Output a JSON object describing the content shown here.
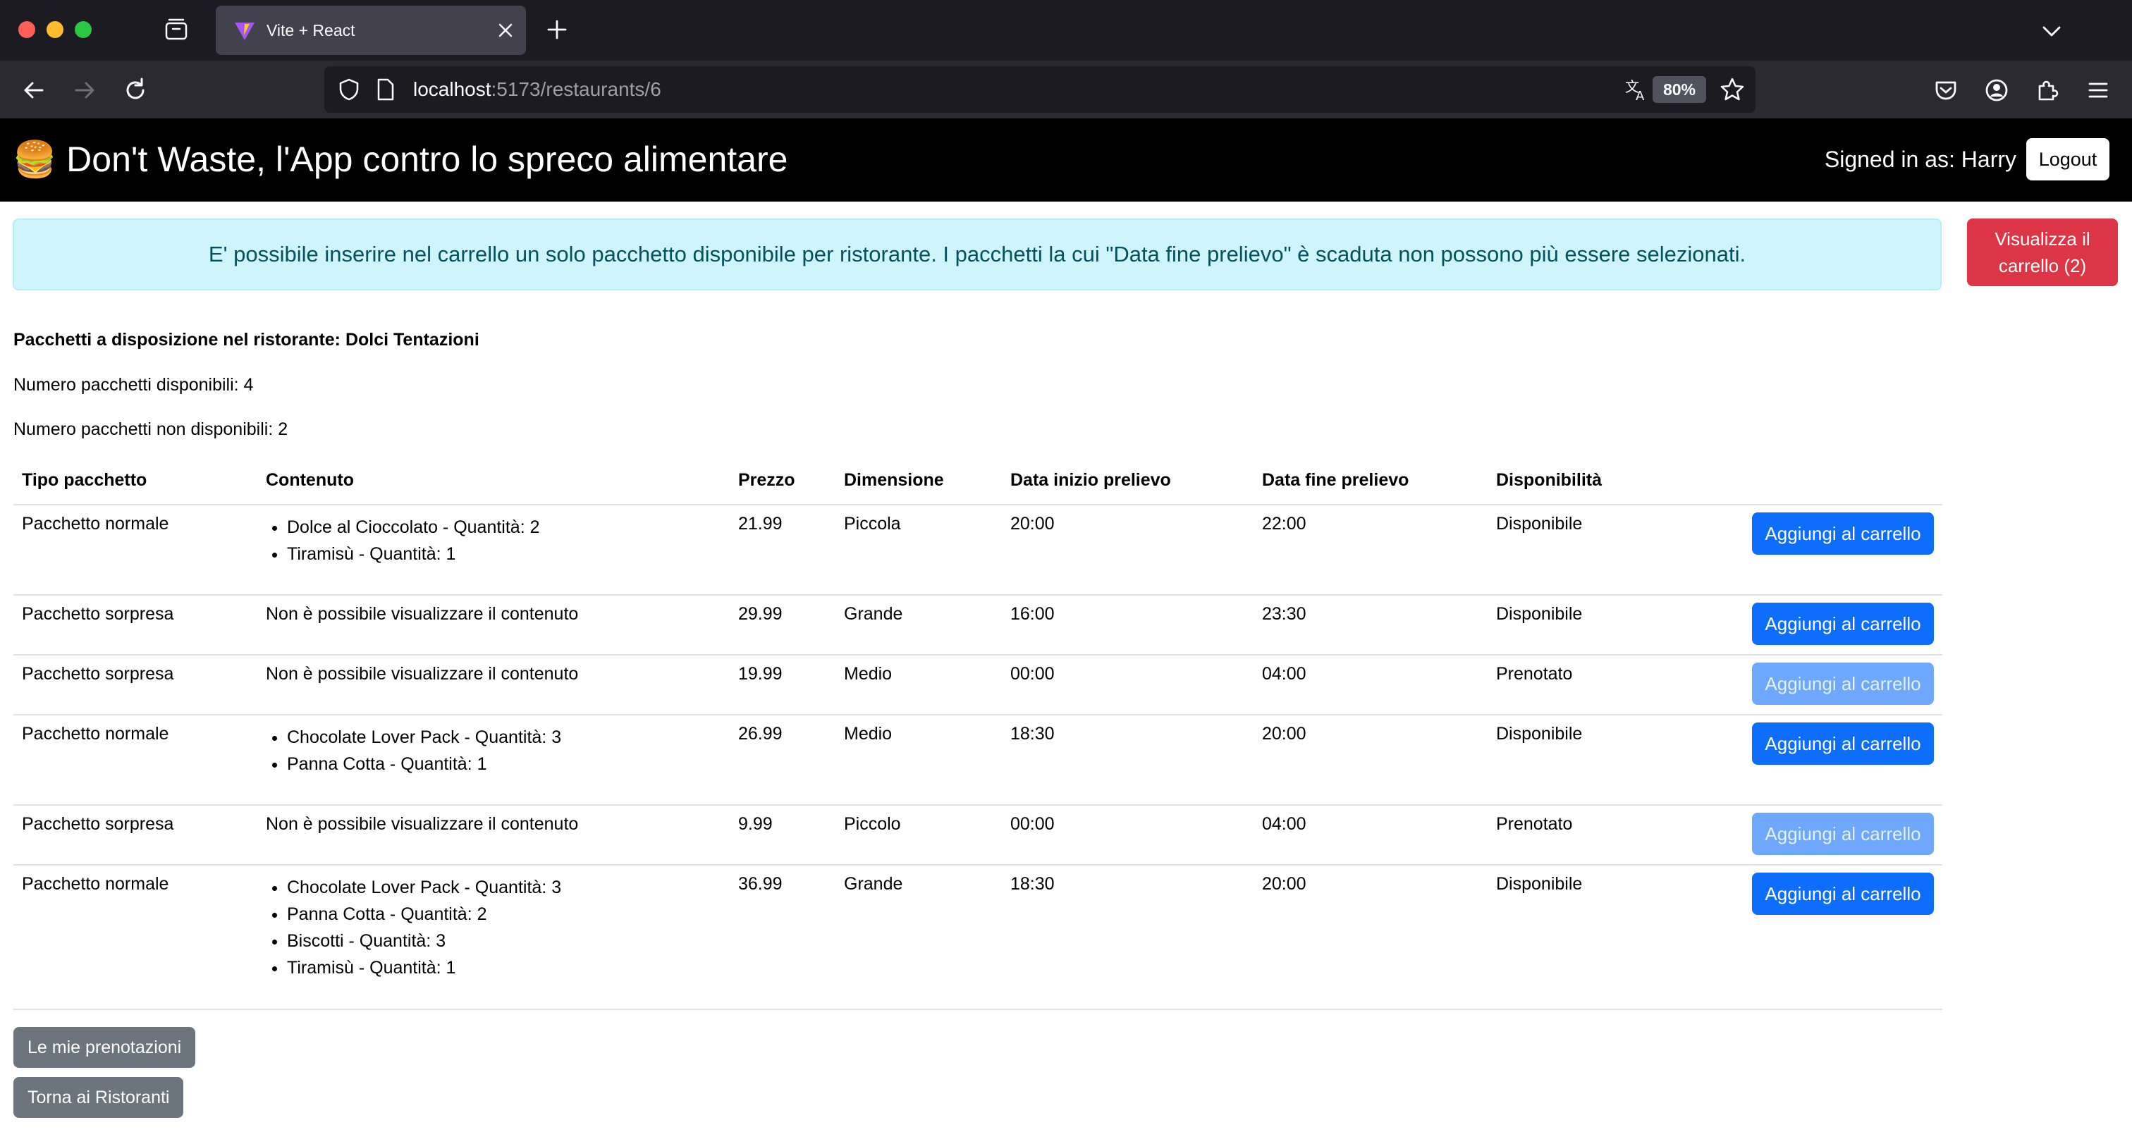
{
  "browser": {
    "tab_title": "Vite + React",
    "url_host": "localhost",
    "url_path": ":5173/restaurants/6",
    "zoom": "80%"
  },
  "header": {
    "brand_emoji": "🍔",
    "brand_text": "Don't Waste, l'App contro lo spreco alimentare",
    "signed_in": "Signed in as: Harry",
    "logout_label": "Logout"
  },
  "alert": {
    "text": "E' possibile inserire nel carrello un solo pacchetto disponibile per ristorante. I pacchetti la cui \"Data fine prelievo\" è scaduta non possono più essere selezionati."
  },
  "cart_button": {
    "line1": "Visualizza il",
    "line2": "carrello (2)"
  },
  "restaurant": {
    "title": "Pacchetti a disposizione nel ristorante: Dolci Tentazioni",
    "available": "Numero pacchetti disponibili: 4",
    "unavailable": "Numero pacchetti non disponibili: 2"
  },
  "table": {
    "headers": [
      "Tipo pacchetto",
      "Contenuto",
      "Prezzo",
      "Dimensione",
      "Data inizio prelievo",
      "Data fine prelievo",
      "Disponibilità"
    ],
    "add_label": "Aggiungi al carrello",
    "rows": [
      {
        "type": "Pacchetto normale",
        "content_text": "",
        "items": [
          "Dolce al Cioccolato - Quantità: 2",
          "Tiramisù - Quantità: 1"
        ],
        "price": "21.99",
        "size": "Piccola",
        "start": "20:00",
        "end": "22:00",
        "status": "Disponibile",
        "enabled": true
      },
      {
        "type": "Pacchetto sorpresa",
        "content_text": "Non è possibile visualizzare il contenuto",
        "items": [],
        "price": "29.99",
        "size": "Grande",
        "start": "16:00",
        "end": "23:30",
        "status": "Disponibile",
        "enabled": true
      },
      {
        "type": "Pacchetto sorpresa",
        "content_text": "Non è possibile visualizzare il contenuto",
        "items": [],
        "price": "19.99",
        "size": "Medio",
        "start": "00:00",
        "end": "04:00",
        "status": "Prenotato",
        "enabled": false
      },
      {
        "type": "Pacchetto normale",
        "content_text": "",
        "items": [
          "Chocolate Lover Pack - Quantità: 3",
          "Panna Cotta - Quantità: 1"
        ],
        "price": "26.99",
        "size": "Medio",
        "start": "18:30",
        "end": "20:00",
        "status": "Disponibile",
        "enabled": true
      },
      {
        "type": "Pacchetto sorpresa",
        "content_text": "Non è possibile visualizzare il contenuto",
        "items": [],
        "price": "9.99",
        "size": "Piccolo",
        "start": "00:00",
        "end": "04:00",
        "status": "Prenotato",
        "enabled": false
      },
      {
        "type": "Pacchetto normale",
        "content_text": "",
        "items": [
          "Chocolate Lover Pack - Quantità: 3",
          "Panna Cotta - Quantità: 2",
          "Biscotti - Quantità: 3",
          "Tiramisù - Quantità: 1"
        ],
        "price": "36.99",
        "size": "Grande",
        "start": "18:30",
        "end": "20:00",
        "status": "Disponibile",
        "enabled": true
      }
    ]
  },
  "footer": {
    "reservations_label": "Le mie prenotazioni",
    "back_label": "Torna ai Ristoranti"
  }
}
